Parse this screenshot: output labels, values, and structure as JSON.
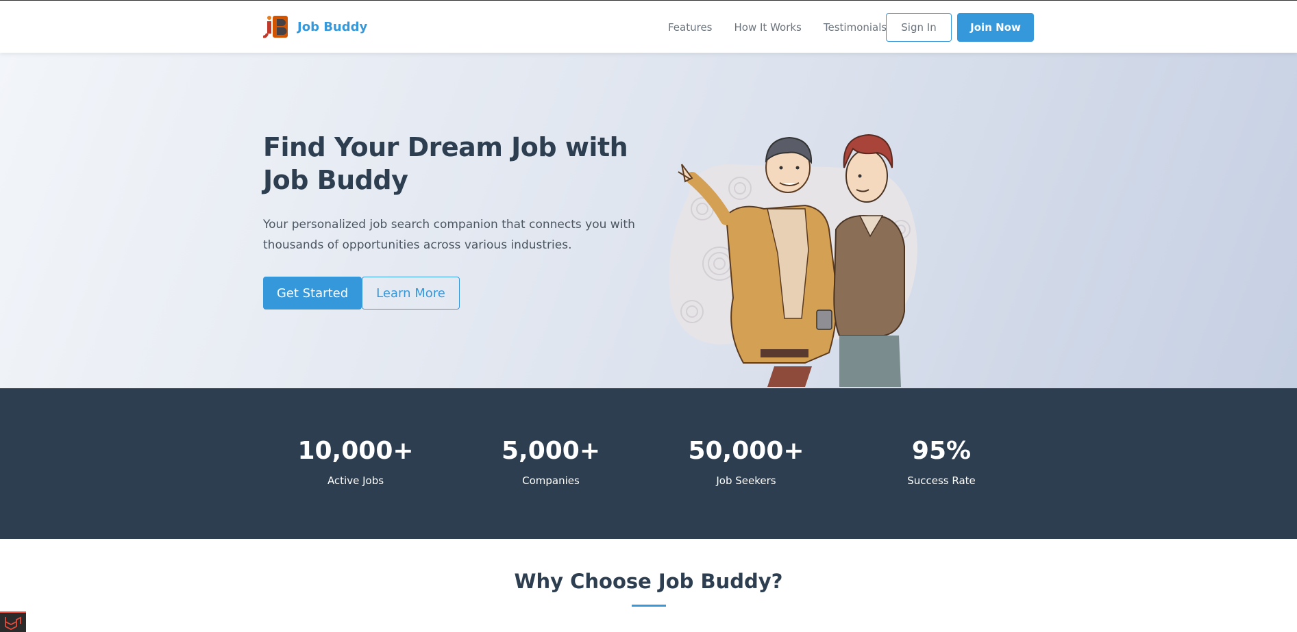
{
  "brand": {
    "name": "Job Buddy",
    "logo_text": "JB"
  },
  "nav": {
    "links": [
      "Features",
      "How It Works",
      "Testimonials"
    ],
    "sign_in": "Sign In",
    "join_now": "Join Now"
  },
  "hero": {
    "title": "Find Your Dream Job with Job Buddy",
    "subtitle": "Your personalized job search companion that connects you with thousands of opportunities across various industries.",
    "primary_button": "Get Started",
    "secondary_button": "Learn More"
  },
  "stats": [
    {
      "value": "10,000+",
      "label": "Active Jobs"
    },
    {
      "value": "5,000+",
      "label": "Companies"
    },
    {
      "value": "50,000+",
      "label": "Job Seekers"
    },
    {
      "value": "95%",
      "label": "Success Rate"
    }
  ],
  "why": {
    "title": "Why Choose Job Buddy?"
  },
  "colors": {
    "accent": "#3498db",
    "dark": "#2d3e50",
    "text": "#2c3e50"
  },
  "icons": {
    "logo": "jb-logo-icon",
    "badge": "debug-toolbar-icon"
  }
}
